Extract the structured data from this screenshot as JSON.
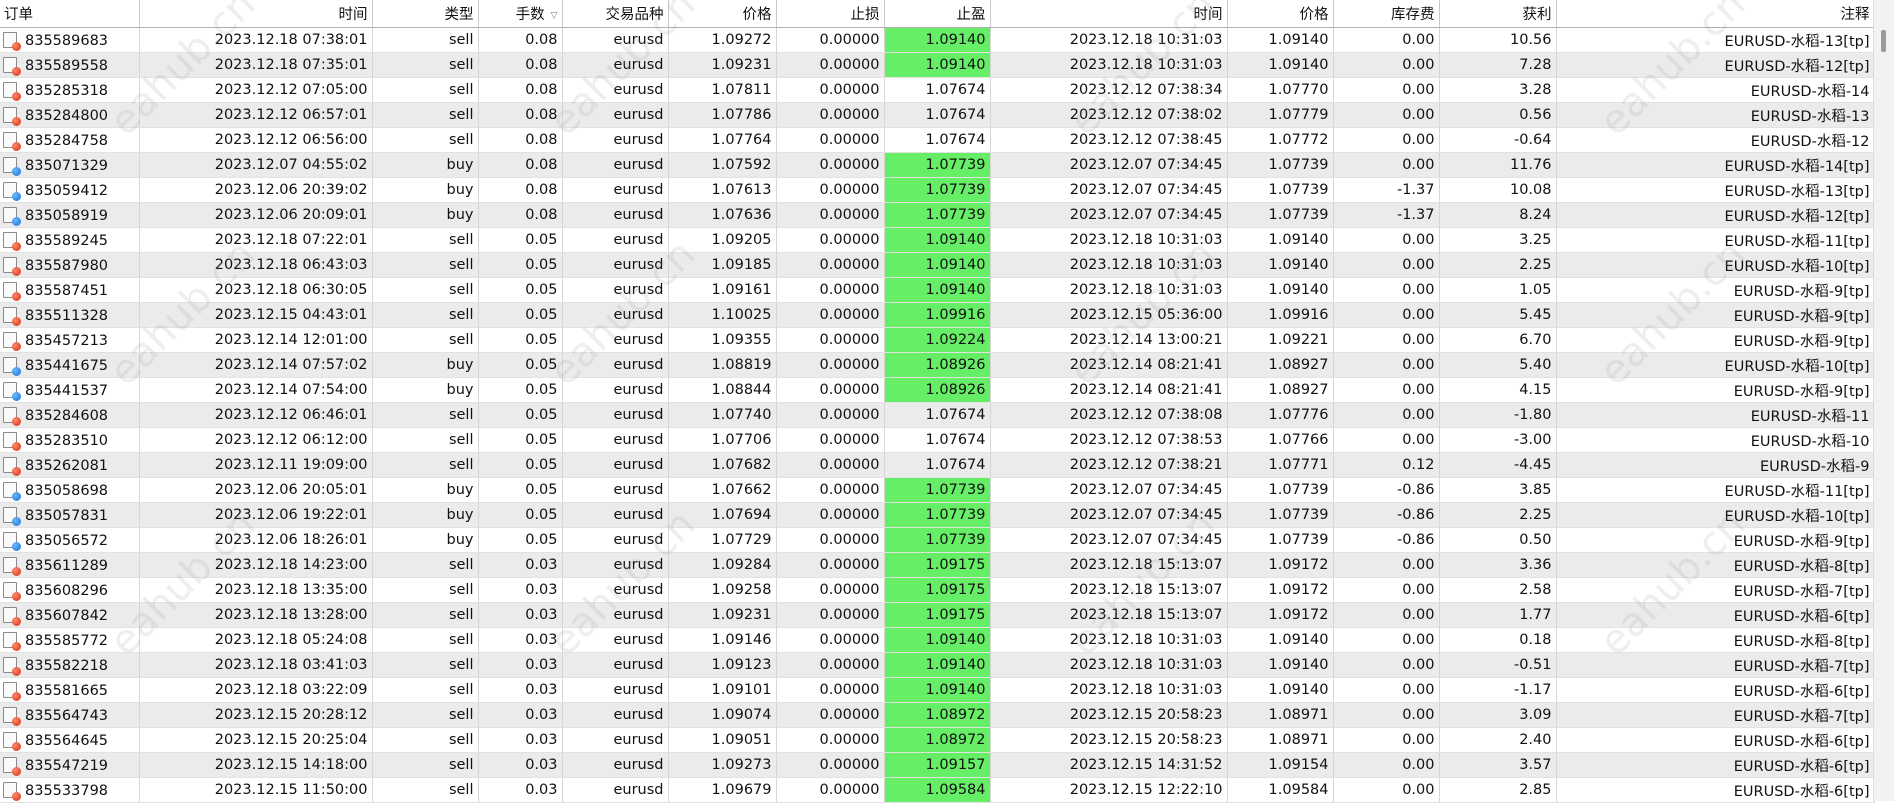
{
  "columns": [
    {
      "key": "order",
      "label": "订单"
    },
    {
      "key": "open_time",
      "label": "时间"
    },
    {
      "key": "type",
      "label": "类型"
    },
    {
      "key": "lots",
      "label": "手数",
      "sort": "▽"
    },
    {
      "key": "symbol",
      "label": "交易品种"
    },
    {
      "key": "open_price",
      "label": "价格"
    },
    {
      "key": "sl",
      "label": "止损"
    },
    {
      "key": "tp",
      "label": "止盈"
    },
    {
      "key": "close_time",
      "label": "时间"
    },
    {
      "key": "close_price",
      "label": "价格"
    },
    {
      "key": "swap",
      "label": "库存费"
    },
    {
      "key": "profit",
      "label": "获利"
    },
    {
      "key": "comment",
      "label": "注释"
    }
  ],
  "rows": [
    {
      "order": "835589683",
      "open_time": "2023.12.18 07:38:01",
      "type": "sell",
      "lots": "0.08",
      "symbol": "eurusd",
      "open_price": "1.09272",
      "sl": "0.00000",
      "tp": "1.09140",
      "tp_hit": true,
      "close_time": "2023.12.18 10:31:03",
      "close_price": "1.09140",
      "swap": "0.00",
      "profit": "10.56",
      "comment": "EURUSD-水稻-13[tp]"
    },
    {
      "order": "835589558",
      "open_time": "2023.12.18 07:35:01",
      "type": "sell",
      "lots": "0.08",
      "symbol": "eurusd",
      "open_price": "1.09231",
      "sl": "0.00000",
      "tp": "1.09140",
      "tp_hit": true,
      "close_time": "2023.12.18 10:31:03",
      "close_price": "1.09140",
      "swap": "0.00",
      "profit": "7.28",
      "comment": "EURUSD-水稻-12[tp]"
    },
    {
      "order": "835285318",
      "open_time": "2023.12.12 07:05:00",
      "type": "sell",
      "lots": "0.08",
      "symbol": "eurusd",
      "open_price": "1.07811",
      "sl": "0.00000",
      "tp": "1.07674",
      "tp_hit": false,
      "close_time": "2023.12.12 07:38:34",
      "close_price": "1.07770",
      "swap": "0.00",
      "profit": "3.28",
      "comment": "EURUSD-水稻-14"
    },
    {
      "order": "835284800",
      "open_time": "2023.12.12 06:57:01",
      "type": "sell",
      "lots": "0.08",
      "symbol": "eurusd",
      "open_price": "1.07786",
      "sl": "0.00000",
      "tp": "1.07674",
      "tp_hit": false,
      "close_time": "2023.12.12 07:38:02",
      "close_price": "1.07779",
      "swap": "0.00",
      "profit": "0.56",
      "comment": "EURUSD-水稻-13"
    },
    {
      "order": "835284758",
      "open_time": "2023.12.12 06:56:00",
      "type": "sell",
      "lots": "0.08",
      "symbol": "eurusd",
      "open_price": "1.07764",
      "sl": "0.00000",
      "tp": "1.07674",
      "tp_hit": false,
      "close_time": "2023.12.12 07:38:45",
      "close_price": "1.07772",
      "swap": "0.00",
      "profit": "-0.64",
      "comment": "EURUSD-水稻-12"
    },
    {
      "order": "835071329",
      "open_time": "2023.12.07 04:55:02",
      "type": "buy",
      "lots": "0.08",
      "symbol": "eurusd",
      "open_price": "1.07592",
      "sl": "0.00000",
      "tp": "1.07739",
      "tp_hit": true,
      "close_time": "2023.12.07 07:34:45",
      "close_price": "1.07739",
      "swap": "0.00",
      "profit": "11.76",
      "comment": "EURUSD-水稻-14[tp]"
    },
    {
      "order": "835059412",
      "open_time": "2023.12.06 20:39:02",
      "type": "buy",
      "lots": "0.08",
      "symbol": "eurusd",
      "open_price": "1.07613",
      "sl": "0.00000",
      "tp": "1.07739",
      "tp_hit": true,
      "close_time": "2023.12.07 07:34:45",
      "close_price": "1.07739",
      "swap": "-1.37",
      "profit": "10.08",
      "comment": "EURUSD-水稻-13[tp]"
    },
    {
      "order": "835058919",
      "open_time": "2023.12.06 20:09:01",
      "type": "buy",
      "lots": "0.08",
      "symbol": "eurusd",
      "open_price": "1.07636",
      "sl": "0.00000",
      "tp": "1.07739",
      "tp_hit": true,
      "close_time": "2023.12.07 07:34:45",
      "close_price": "1.07739",
      "swap": "-1.37",
      "profit": "8.24",
      "comment": "EURUSD-水稻-12[tp]"
    },
    {
      "order": "835589245",
      "open_time": "2023.12.18 07:22:01",
      "type": "sell",
      "lots": "0.05",
      "symbol": "eurusd",
      "open_price": "1.09205",
      "sl": "0.00000",
      "tp": "1.09140",
      "tp_hit": true,
      "close_time": "2023.12.18 10:31:03",
      "close_price": "1.09140",
      "swap": "0.00",
      "profit": "3.25",
      "comment": "EURUSD-水稻-11[tp]"
    },
    {
      "order": "835587980",
      "open_time": "2023.12.18 06:43:03",
      "type": "sell",
      "lots": "0.05",
      "symbol": "eurusd",
      "open_price": "1.09185",
      "sl": "0.00000",
      "tp": "1.09140",
      "tp_hit": true,
      "close_time": "2023.12.18 10:31:03",
      "close_price": "1.09140",
      "swap": "0.00",
      "profit": "2.25",
      "comment": "EURUSD-水稻-10[tp]"
    },
    {
      "order": "835587451",
      "open_time": "2023.12.18 06:30:05",
      "type": "sell",
      "lots": "0.05",
      "symbol": "eurusd",
      "open_price": "1.09161",
      "sl": "0.00000",
      "tp": "1.09140",
      "tp_hit": true,
      "close_time": "2023.12.18 10:31:03",
      "close_price": "1.09140",
      "swap": "0.00",
      "profit": "1.05",
      "comment": "EURUSD-水稻-9[tp]"
    },
    {
      "order": "835511328",
      "open_time": "2023.12.15 04:43:01",
      "type": "sell",
      "lots": "0.05",
      "symbol": "eurusd",
      "open_price": "1.10025",
      "sl": "0.00000",
      "tp": "1.09916",
      "tp_hit": true,
      "close_time": "2023.12.15 05:36:00",
      "close_price": "1.09916",
      "swap": "0.00",
      "profit": "5.45",
      "comment": "EURUSD-水稻-9[tp]"
    },
    {
      "order": "835457213",
      "open_time": "2023.12.14 12:01:00",
      "type": "sell",
      "lots": "0.05",
      "symbol": "eurusd",
      "open_price": "1.09355",
      "sl": "0.00000",
      "tp": "1.09224",
      "tp_hit": true,
      "close_time": "2023.12.14 13:00:21",
      "close_price": "1.09221",
      "swap": "0.00",
      "profit": "6.70",
      "comment": "EURUSD-水稻-9[tp]"
    },
    {
      "order": "835441675",
      "open_time": "2023.12.14 07:57:02",
      "type": "buy",
      "lots": "0.05",
      "symbol": "eurusd",
      "open_price": "1.08819",
      "sl": "0.00000",
      "tp": "1.08926",
      "tp_hit": true,
      "close_time": "2023.12.14 08:21:41",
      "close_price": "1.08927",
      "swap": "0.00",
      "profit": "5.40",
      "comment": "EURUSD-水稻-10[tp]"
    },
    {
      "order": "835441537",
      "open_time": "2023.12.14 07:54:00",
      "type": "buy",
      "lots": "0.05",
      "symbol": "eurusd",
      "open_price": "1.08844",
      "sl": "0.00000",
      "tp": "1.08926",
      "tp_hit": true,
      "close_time": "2023.12.14 08:21:41",
      "close_price": "1.08927",
      "swap": "0.00",
      "profit": "4.15",
      "comment": "EURUSD-水稻-9[tp]"
    },
    {
      "order": "835284608",
      "open_time": "2023.12.12 06:46:01",
      "type": "sell",
      "lots": "0.05",
      "symbol": "eurusd",
      "open_price": "1.07740",
      "sl": "0.00000",
      "tp": "1.07674",
      "tp_hit": false,
      "close_time": "2023.12.12 07:38:08",
      "close_price": "1.07776",
      "swap": "0.00",
      "profit": "-1.80",
      "comment": "EURUSD-水稻-11"
    },
    {
      "order": "835283510",
      "open_time": "2023.12.12 06:12:00",
      "type": "sell",
      "lots": "0.05",
      "symbol": "eurusd",
      "open_price": "1.07706",
      "sl": "0.00000",
      "tp": "1.07674",
      "tp_hit": false,
      "close_time": "2023.12.12 07:38:53",
      "close_price": "1.07766",
      "swap": "0.00",
      "profit": "-3.00",
      "comment": "EURUSD-水稻-10"
    },
    {
      "order": "835262081",
      "open_time": "2023.12.11 19:09:00",
      "type": "sell",
      "lots": "0.05",
      "symbol": "eurusd",
      "open_price": "1.07682",
      "sl": "0.00000",
      "tp": "1.07674",
      "tp_hit": false,
      "close_time": "2023.12.12 07:38:21",
      "close_price": "1.07771",
      "swap": "0.12",
      "profit": "-4.45",
      "comment": "EURUSD-水稻-9"
    },
    {
      "order": "835058698",
      "open_time": "2023.12.06 20:05:01",
      "type": "buy",
      "lots": "0.05",
      "symbol": "eurusd",
      "open_price": "1.07662",
      "sl": "0.00000",
      "tp": "1.07739",
      "tp_hit": true,
      "close_time": "2023.12.07 07:34:45",
      "close_price": "1.07739",
      "swap": "-0.86",
      "profit": "3.85",
      "comment": "EURUSD-水稻-11[tp]"
    },
    {
      "order": "835057831",
      "open_time": "2023.12.06 19:22:01",
      "type": "buy",
      "lots": "0.05",
      "symbol": "eurusd",
      "open_price": "1.07694",
      "sl": "0.00000",
      "tp": "1.07739",
      "tp_hit": true,
      "close_time": "2023.12.07 07:34:45",
      "close_price": "1.07739",
      "swap": "-0.86",
      "profit": "2.25",
      "comment": "EURUSD-水稻-10[tp]"
    },
    {
      "order": "835056572",
      "open_time": "2023.12.06 18:26:01",
      "type": "buy",
      "lots": "0.05",
      "symbol": "eurusd",
      "open_price": "1.07729",
      "sl": "0.00000",
      "tp": "1.07739",
      "tp_hit": true,
      "close_time": "2023.12.07 07:34:45",
      "close_price": "1.07739",
      "swap": "-0.86",
      "profit": "0.50",
      "comment": "EURUSD-水稻-9[tp]"
    },
    {
      "order": "835611289",
      "open_time": "2023.12.18 14:23:00",
      "type": "sell",
      "lots": "0.03",
      "symbol": "eurusd",
      "open_price": "1.09284",
      "sl": "0.00000",
      "tp": "1.09175",
      "tp_hit": true,
      "close_time": "2023.12.18 15:13:07",
      "close_price": "1.09172",
      "swap": "0.00",
      "profit": "3.36",
      "comment": "EURUSD-水稻-8[tp]"
    },
    {
      "order": "835608296",
      "open_time": "2023.12.18 13:35:00",
      "type": "sell",
      "lots": "0.03",
      "symbol": "eurusd",
      "open_price": "1.09258",
      "sl": "0.00000",
      "tp": "1.09175",
      "tp_hit": true,
      "close_time": "2023.12.18 15:13:07",
      "close_price": "1.09172",
      "swap": "0.00",
      "profit": "2.58",
      "comment": "EURUSD-水稻-7[tp]"
    },
    {
      "order": "835607842",
      "open_time": "2023.12.18 13:28:00",
      "type": "sell",
      "lots": "0.03",
      "symbol": "eurusd",
      "open_price": "1.09231",
      "sl": "0.00000",
      "tp": "1.09175",
      "tp_hit": true,
      "close_time": "2023.12.18 15:13:07",
      "close_price": "1.09172",
      "swap": "0.00",
      "profit": "1.77",
      "comment": "EURUSD-水稻-6[tp]"
    },
    {
      "order": "835585772",
      "open_time": "2023.12.18 05:24:08",
      "type": "sell",
      "lots": "0.03",
      "symbol": "eurusd",
      "open_price": "1.09146",
      "sl": "0.00000",
      "tp": "1.09140",
      "tp_hit": true,
      "close_time": "2023.12.18 10:31:03",
      "close_price": "1.09140",
      "swap": "0.00",
      "profit": "0.18",
      "comment": "EURUSD-水稻-8[tp]"
    },
    {
      "order": "835582218",
      "open_time": "2023.12.18 03:41:03",
      "type": "sell",
      "lots": "0.03",
      "symbol": "eurusd",
      "open_price": "1.09123",
      "sl": "0.00000",
      "tp": "1.09140",
      "tp_hit": true,
      "close_time": "2023.12.18 10:31:03",
      "close_price": "1.09140",
      "swap": "0.00",
      "profit": "-0.51",
      "comment": "EURUSD-水稻-7[tp]"
    },
    {
      "order": "835581665",
      "open_time": "2023.12.18 03:22:09",
      "type": "sell",
      "lots": "0.03",
      "symbol": "eurusd",
      "open_price": "1.09101",
      "sl": "0.00000",
      "tp": "1.09140",
      "tp_hit": true,
      "close_time": "2023.12.18 10:31:03",
      "close_price": "1.09140",
      "swap": "0.00",
      "profit": "-1.17",
      "comment": "EURUSD-水稻-6[tp]"
    },
    {
      "order": "835564743",
      "open_time": "2023.12.15 20:28:12",
      "type": "sell",
      "lots": "0.03",
      "symbol": "eurusd",
      "open_price": "1.09074",
      "sl": "0.00000",
      "tp": "1.08972",
      "tp_hit": true,
      "close_time": "2023.12.15 20:58:23",
      "close_price": "1.08971",
      "swap": "0.00",
      "profit": "3.09",
      "comment": "EURUSD-水稻-7[tp]"
    },
    {
      "order": "835564645",
      "open_time": "2023.12.15 20:25:04",
      "type": "sell",
      "lots": "0.03",
      "symbol": "eurusd",
      "open_price": "1.09051",
      "sl": "0.00000",
      "tp": "1.08972",
      "tp_hit": true,
      "close_time": "2023.12.15 20:58:23",
      "close_price": "1.08971",
      "swap": "0.00",
      "profit": "2.40",
      "comment": "EURUSD-水稻-6[tp]"
    },
    {
      "order": "835547219",
      "open_time": "2023.12.15 14:18:00",
      "type": "sell",
      "lots": "0.03",
      "symbol": "eurusd",
      "open_price": "1.09273",
      "sl": "0.00000",
      "tp": "1.09157",
      "tp_hit": true,
      "close_time": "2023.12.15 14:31:52",
      "close_price": "1.09154",
      "swap": "0.00",
      "profit": "3.57",
      "comment": "EURUSD-水稻-6[tp]"
    },
    {
      "order": "835533798",
      "open_time": "2023.12.15 11:50:00",
      "type": "sell",
      "lots": "0.03",
      "symbol": "eurusd",
      "open_price": "1.09679",
      "sl": "0.00000",
      "tp": "1.09584",
      "tp_hit": true,
      "close_time": "2023.12.15 12:22:10",
      "close_price": "1.09584",
      "swap": "0.00",
      "profit": "2.85",
      "comment": "EURUSD-水稻-6[tp]"
    }
  ],
  "colors": {
    "tp_hit": "#66ee66",
    "row_alt": "#ebebeb",
    "sell_icon": "#d42a10",
    "buy_icon": "#1a6fd0"
  },
  "icons": {
    "sell": "sell-order-icon",
    "buy": "buy-order-icon"
  },
  "watermark_text": "eahub.cn"
}
